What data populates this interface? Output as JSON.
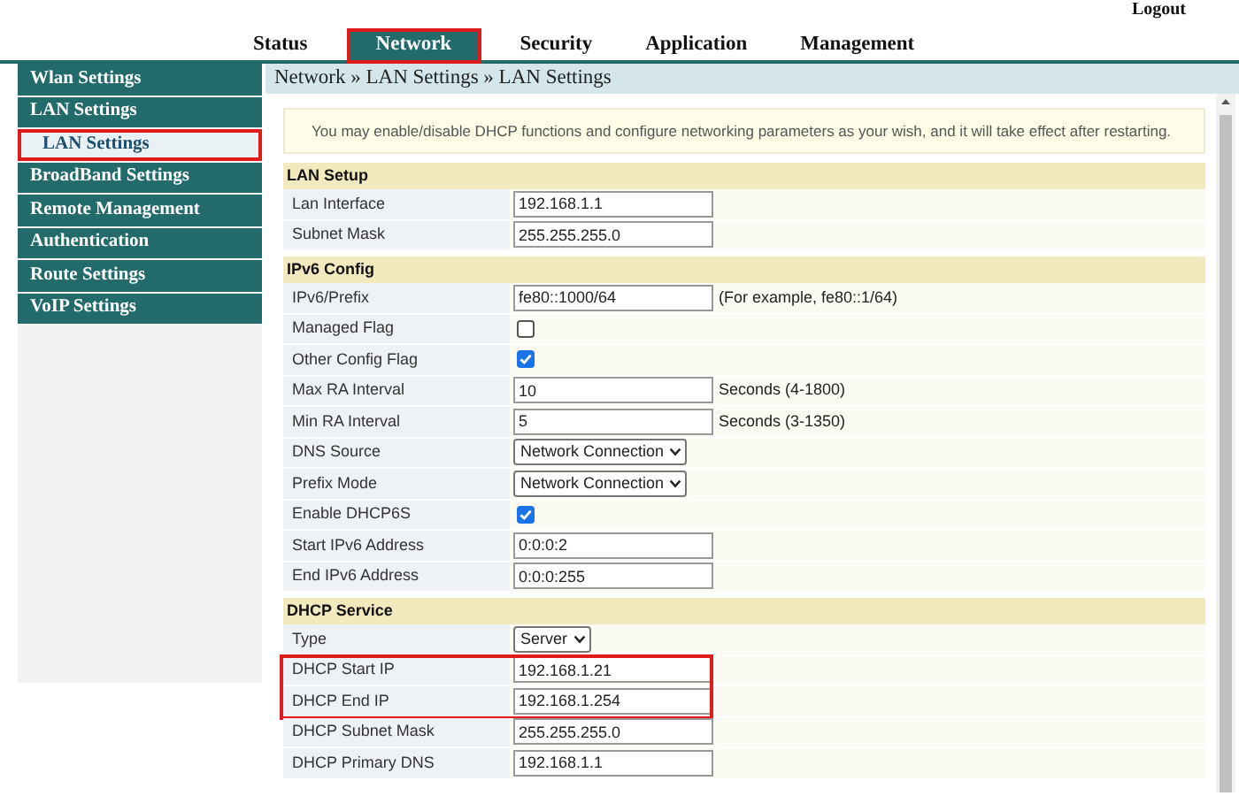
{
  "header": {
    "logout": "Logout"
  },
  "tabs": [
    {
      "label": "Status",
      "selected": false,
      "highlighted": false
    },
    {
      "label": "Network",
      "selected": true,
      "highlighted": true
    },
    {
      "label": "Security",
      "selected": false,
      "highlighted": false
    },
    {
      "label": "Application",
      "selected": false,
      "highlighted": false
    },
    {
      "label": "Management",
      "selected": false,
      "highlighted": false
    }
  ],
  "sidebar": {
    "items": [
      {
        "label": "Wlan Settings",
        "kind": "group",
        "selected": false,
        "highlighted": false
      },
      {
        "label": "LAN Settings",
        "kind": "group",
        "selected": false,
        "highlighted": false
      },
      {
        "label": "LAN Settings",
        "kind": "sub",
        "selected": true,
        "highlighted": true
      },
      {
        "label": "BroadBand Settings",
        "kind": "group",
        "selected": false,
        "highlighted": false
      },
      {
        "label": "Remote Management",
        "kind": "group",
        "selected": false,
        "highlighted": false
      },
      {
        "label": "Authentication",
        "kind": "group",
        "selected": false,
        "highlighted": false
      },
      {
        "label": "Route Settings",
        "kind": "group",
        "selected": false,
        "highlighted": false
      },
      {
        "label": "VoIP Settings",
        "kind": "group",
        "selected": false,
        "highlighted": false
      }
    ]
  },
  "breadcrumb": "Network » LAN Settings » LAN Settings",
  "notice": "You may enable/disable DHCP functions and configure networking parameters as your wish, and it will take effect after restarting.",
  "sections": [
    {
      "title": "LAN Setup",
      "rows": [
        {
          "label": "Lan Interface",
          "kind": "text",
          "value": "192.168.1.1",
          "highlighted": false
        },
        {
          "label": "Subnet Mask",
          "kind": "text",
          "value": "255.255.255.0",
          "highlighted": false
        }
      ]
    },
    {
      "title": "IPv6 Config",
      "rows": [
        {
          "label": "IPv6/Prefix",
          "kind": "text",
          "value": "fe80::1000/64",
          "note": "(For example, fe80::1/64)",
          "highlighted": false
        },
        {
          "label": "Managed Flag",
          "kind": "checkbox",
          "checked": false,
          "highlighted": false
        },
        {
          "label": "Other Config Flag",
          "kind": "checkbox",
          "checked": true,
          "highlighted": false
        },
        {
          "label": "Max RA Interval",
          "kind": "text",
          "value": "10",
          "note": "Seconds (4-1800)",
          "highlighted": false
        },
        {
          "label": "Min RA Interval",
          "kind": "text",
          "value": "5",
          "note": "Seconds (3-1350)",
          "highlighted": false
        },
        {
          "label": "DNS Source",
          "kind": "select",
          "value": "Network Connection",
          "highlighted": false
        },
        {
          "label": "Prefix Mode",
          "kind": "select",
          "value": "Network Connection",
          "highlighted": false
        },
        {
          "label": "Enable DHCP6S",
          "kind": "checkbox",
          "checked": true,
          "highlighted": false
        },
        {
          "label": "Start IPv6 Address",
          "kind": "text",
          "value": "0:0:0:2",
          "highlighted": false
        },
        {
          "label": "End IPv6 Address",
          "kind": "text",
          "value": "0:0:0:255",
          "highlighted": false
        }
      ]
    },
    {
      "title": "DHCP Service",
      "rows": [
        {
          "label": "Type",
          "kind": "select",
          "value": "Server",
          "highlighted": false
        },
        {
          "label": "DHCP Start IP",
          "kind": "text",
          "value": "192.168.1.21",
          "highlighted": true
        },
        {
          "label": "DHCP End IP",
          "kind": "text",
          "value": "192.168.1.254",
          "highlighted": true
        },
        {
          "label": "DHCP Subnet Mask",
          "kind": "text",
          "value": "255.255.255.0",
          "highlighted": false
        },
        {
          "label": "DHCP Primary DNS",
          "kind": "text",
          "value": "192.168.1.1",
          "highlighted": false
        }
      ]
    }
  ]
}
